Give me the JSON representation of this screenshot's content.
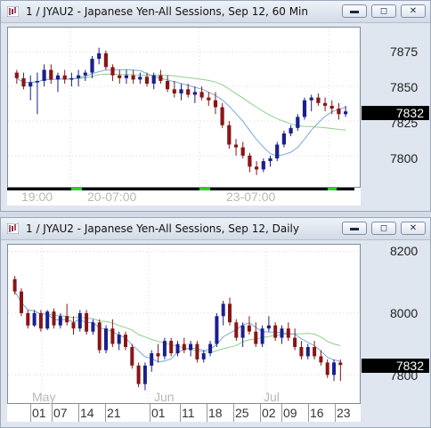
{
  "window1": {
    "title": "1 / JYAU2 - Japanese Yen-All Sessions, Sep 12, 60 Min",
    "y_labels": [
      "7875",
      "7850",
      "7825",
      "7800"
    ],
    "last_price": "7832",
    "x_labels": [
      "19:00",
      "20-07:00",
      "23-07:00"
    ],
    "buttons": {
      "minimize": "▬",
      "restore": "◻",
      "close": "✕"
    }
  },
  "window2": {
    "title": "1 / JYAU2 - Japanese Yen-All Sessions, Sep 12, Daily",
    "y_labels": [
      "8200",
      "8000",
      "7800"
    ],
    "last_price": "7832",
    "month_labels": [
      "May",
      "Jun",
      "Jul"
    ],
    "day_labels": [
      "01",
      "07",
      "14",
      "21",
      "01",
      "11",
      "18",
      "25",
      "02",
      "09",
      "16",
      "23"
    ],
    "buttons": {
      "minimize": "▬",
      "restore": "◻",
      "close": "✕"
    }
  },
  "colors": {
    "up": "#1a1f8f",
    "down": "#8b1414",
    "ma_fast": "#7aa7e0",
    "ma_slow": "#8fcf8f",
    "session_green": "#33cc33"
  },
  "chart_data": [
    {
      "type": "candlestick",
      "title": "1 / JYAU2 - Japanese Yen-All Sessions, Sep 12, 60 Min",
      "ylim": [
        7780,
        7890
      ],
      "x_tick_labels": [
        "19:00",
        "20-07:00",
        "23-07:00"
      ],
      "y_tick_labels": [
        "7875",
        "7850",
        "7825",
        "7800"
      ],
      "last_price": 7832,
      "candles": [
        [
          7860,
          7862,
          7852,
          7856
        ],
        [
          7856,
          7860,
          7848,
          7850
        ],
        [
          7850,
          7858,
          7840,
          7853
        ],
        [
          7853,
          7860,
          7830,
          7854
        ],
        [
          7854,
          7866,
          7850,
          7862
        ],
        [
          7862,
          7866,
          7852,
          7855
        ],
        [
          7855,
          7860,
          7846,
          7858
        ],
        [
          7858,
          7862,
          7852,
          7855
        ],
        [
          7855,
          7860,
          7850,
          7856
        ],
        [
          7856,
          7862,
          7850,
          7858
        ],
        [
          7858,
          7862,
          7854,
          7860
        ],
        [
          7860,
          7872,
          7856,
          7870
        ],
        [
          7870,
          7878,
          7866,
          7874
        ],
        [
          7874,
          7876,
          7862,
          7864
        ],
        [
          7864,
          7866,
          7854,
          7858
        ],
        [
          7858,
          7862,
          7852,
          7856
        ],
        [
          7856,
          7862,
          7852,
          7858
        ],
        [
          7858,
          7862,
          7852,
          7855
        ],
        [
          7855,
          7860,
          7852,
          7857
        ],
        [
          7857,
          7860,
          7850,
          7852
        ],
        [
          7852,
          7860,
          7848,
          7858
        ],
        [
          7858,
          7862,
          7852,
          7854
        ],
        [
          7854,
          7858,
          7846,
          7848
        ],
        [
          7848,
          7854,
          7842,
          7845
        ],
        [
          7845,
          7852,
          7840,
          7848
        ],
        [
          7848,
          7852,
          7842,
          7844
        ],
        [
          7844,
          7850,
          7838,
          7846
        ],
        [
          7846,
          7850,
          7840,
          7842
        ],
        [
          7842,
          7846,
          7836,
          7840
        ],
        [
          7840,
          7846,
          7830,
          7835
        ],
        [
          7835,
          7838,
          7820,
          7822
        ],
        [
          7822,
          7825,
          7805,
          7808
        ],
        [
          7808,
          7812,
          7800,
          7806
        ],
        [
          7806,
          7810,
          7798,
          7800
        ],
        [
          7800,
          7802,
          7788,
          7792
        ],
        [
          7792,
          7796,
          7786,
          7790
        ],
        [
          7790,
          7798,
          7788,
          7796
        ],
        [
          7796,
          7800,
          7792,
          7798
        ],
        [
          7798,
          7810,
          7796,
          7808
        ],
        [
          7808,
          7818,
          7806,
          7816
        ],
        [
          7816,
          7822,
          7814,
          7820
        ],
        [
          7820,
          7830,
          7818,
          7828
        ],
        [
          7828,
          7842,
          7826,
          7840
        ],
        [
          7840,
          7844,
          7832,
          7842
        ],
        [
          7842,
          7845,
          7836,
          7838
        ],
        [
          7838,
          7842,
          7832,
          7836
        ],
        [
          7836,
          7840,
          7830,
          7834
        ],
        [
          7834,
          7838,
          7826,
          7830
        ],
        [
          7830,
          7836,
          7828,
          7832
        ]
      ]
    },
    {
      "type": "candlestick",
      "title": "1 / JYAU2 - Japanese Yen-All Sessions, Sep 12, Daily",
      "ylim": [
        7720,
        8210
      ],
      "x_tick_labels": [
        "01",
        "07",
        "14",
        "21",
        "01",
        "11",
        "18",
        "25",
        "02",
        "09",
        "16",
        "23"
      ],
      "month_labels": [
        "May",
        "Jun",
        "Jul"
      ],
      "y_tick_labels": [
        "8200",
        "8000",
        "7800"
      ],
      "last_price": 7832,
      "candles": [
        [
          8110,
          8120,
          8060,
          8070
        ],
        [
          8070,
          8080,
          7990,
          8000
        ],
        [
          8000,
          8010,
          7950,
          7960
        ],
        [
          7960,
          8010,
          7955,
          8000
        ],
        [
          8000,
          8010,
          7940,
          7950
        ],
        [
          7950,
          8010,
          7945,
          8005
        ],
        [
          8005,
          8015,
          7950,
          7960
        ],
        [
          7960,
          8000,
          7950,
          7990
        ],
        [
          7990,
          8030,
          7960,
          7970
        ],
        [
          7970,
          7990,
          7930,
          7950
        ],
        [
          7950,
          8010,
          7940,
          8000
        ],
        [
          8000,
          8010,
          7930,
          7940
        ],
        [
          7940,
          7980,
          7930,
          7970
        ],
        [
          7970,
          7980,
          7870,
          7880
        ],
        [
          7880,
          7960,
          7870,
          7950
        ],
        [
          7950,
          7980,
          7890,
          7900
        ],
        [
          7900,
          7940,
          7880,
          7930
        ],
        [
          7930,
          7940,
          7880,
          7890
        ],
        [
          7890,
          7900,
          7820,
          7830
        ],
        [
          7830,
          7840,
          7760,
          7770
        ],
        [
          7770,
          7840,
          7750,
          7830
        ],
        [
          7830,
          7880,
          7810,
          7870
        ],
        [
          7870,
          7900,
          7840,
          7860
        ],
        [
          7860,
          7920,
          7850,
          7910
        ],
        [
          7910,
          7920,
          7860,
          7870
        ],
        [
          7870,
          7910,
          7860,
          7900
        ],
        [
          7900,
          7920,
          7870,
          7880
        ],
        [
          7880,
          7910,
          7860,
          7900
        ],
        [
          7900,
          7910,
          7840,
          7850
        ],
        [
          7850,
          7880,
          7840,
          7870
        ],
        [
          7870,
          7910,
          7860,
          7900
        ],
        [
          7900,
          8000,
          7890,
          7990
        ],
        [
          7990,
          8040,
          7960,
          8030
        ],
        [
          8030,
          8050,
          7960,
          7970
        ],
        [
          7970,
          7980,
          7910,
          7920
        ],
        [
          7920,
          7970,
          7890,
          7960
        ],
        [
          7960,
          7990,
          7930,
          7940
        ],
        [
          7940,
          7970,
          7890,
          7900
        ],
        [
          7900,
          7960,
          7890,
          7950
        ],
        [
          7950,
          7990,
          7940,
          7960
        ],
        [
          7960,
          7970,
          7910,
          7920
        ],
        [
          7920,
          7960,
          7900,
          7950
        ],
        [
          7950,
          7970,
          7910,
          7920
        ],
        [
          7920,
          7950,
          7880,
          7890
        ],
        [
          7890,
          7910,
          7850,
          7860
        ],
        [
          7860,
          7900,
          7850,
          7890
        ],
        [
          7890,
          7910,
          7850,
          7860
        ],
        [
          7860,
          7880,
          7830,
          7840
        ],
        [
          7840,
          7850,
          7790,
          7800
        ],
        [
          7800,
          7850,
          7780,
          7840
        ],
        [
          7840,
          7850,
          7780,
          7832
        ]
      ]
    }
  ]
}
